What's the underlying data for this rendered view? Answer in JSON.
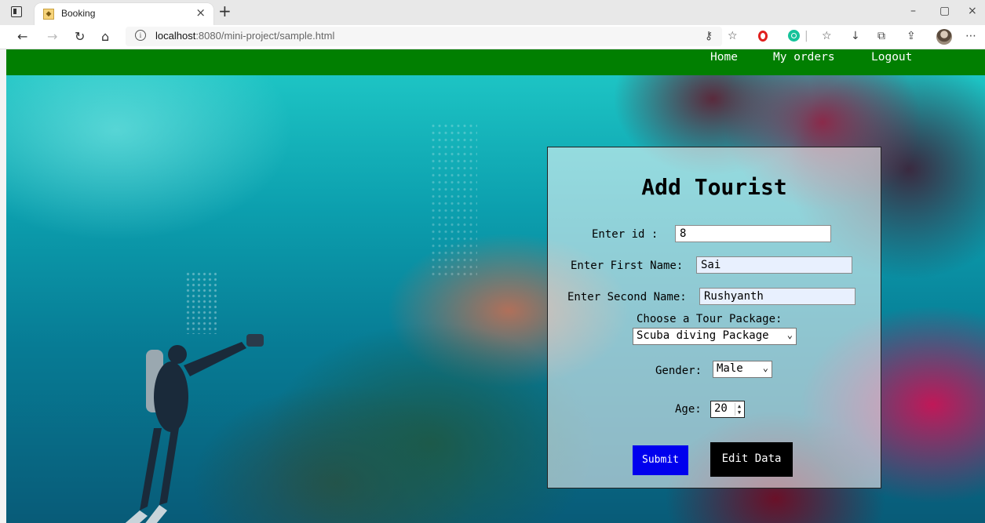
{
  "browser": {
    "tab_title": "Booking",
    "tab_close": "×",
    "new_tab": "+",
    "url_host": "localhost",
    "url_path": ":8080/mini-project/sample.html",
    "window_minimize": "–",
    "window_maximize": "▢",
    "window_close": "×"
  },
  "navbar": {
    "color": "#017f01",
    "links": [
      "Home",
      "My orders",
      "Logout"
    ]
  },
  "form": {
    "heading": "Add Tourist",
    "id_label": "Enter id :",
    "id_value": "8",
    "first_name_label": "Enter First Name:",
    "first_name_value": "Sai",
    "second_name_label": "Enter Second Name:",
    "second_name_value": "Rushyanth",
    "package_label": "Choose a Tour Package:",
    "package_value": "Scuba diving Package",
    "gender_label": "Gender:",
    "gender_value": "Male",
    "age_label": "Age:",
    "age_value": "20",
    "submit_label": "Submit",
    "edit_label": "Edit Data",
    "submit_color": "#0000ee",
    "edit_color": "#000000"
  }
}
